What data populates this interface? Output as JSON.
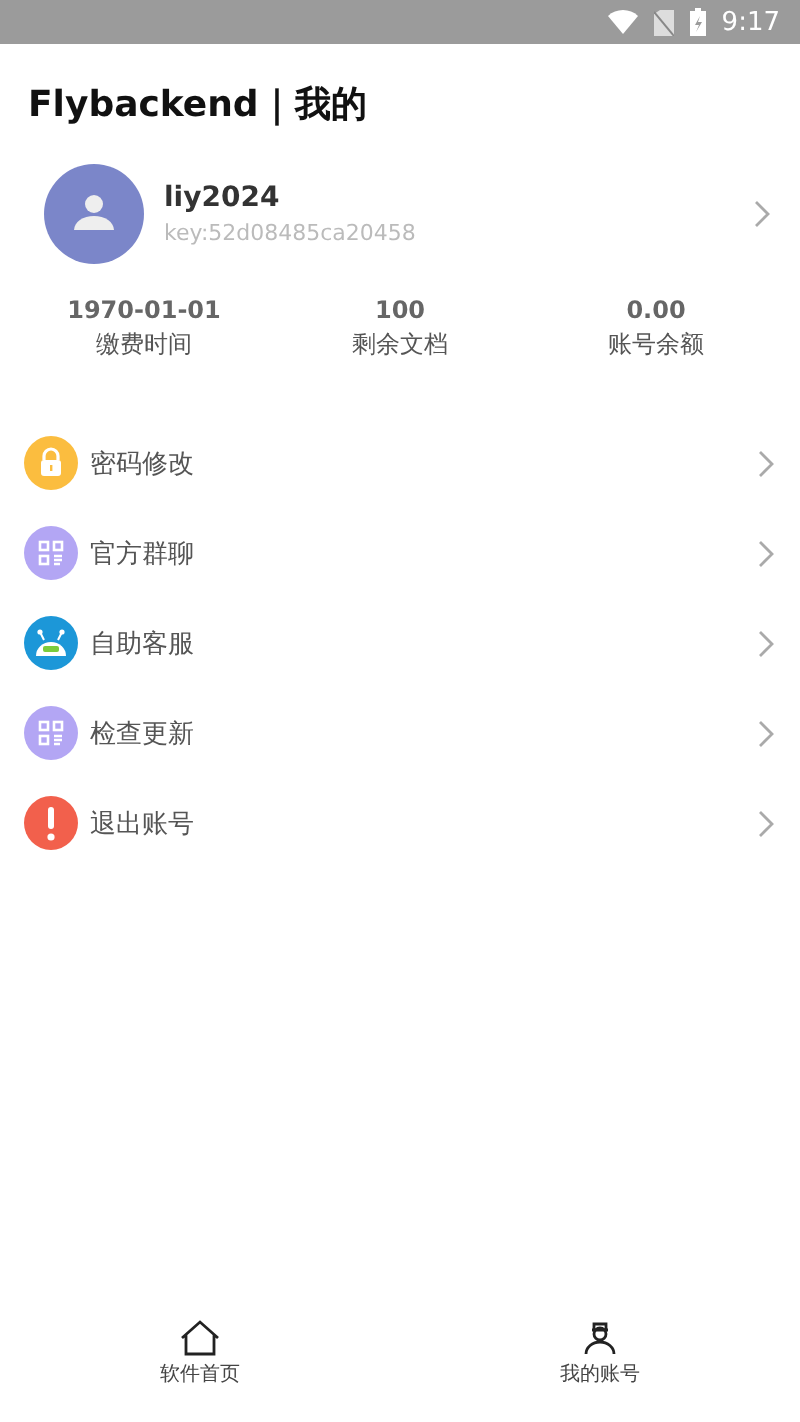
{
  "status_bar": {
    "time": "9:17"
  },
  "title": "Flybackend｜我的",
  "profile": {
    "name": "liy2024",
    "key": "key:52d08485ca20458"
  },
  "stats": [
    {
      "value": "1970-01-01",
      "label": "缴费时间"
    },
    {
      "value": "100",
      "label": "剩余文档"
    },
    {
      "value": "0.00",
      "label": "账号余额"
    }
  ],
  "menu": [
    {
      "kind": "lock",
      "label": "密码修改"
    },
    {
      "kind": "qr",
      "label": "官方群聊"
    },
    {
      "kind": "robot",
      "label": "自助客服"
    },
    {
      "kind": "qr",
      "label": "检查更新"
    },
    {
      "kind": "alert",
      "label": "退出账号"
    }
  ],
  "nav": [
    {
      "kind": "home",
      "label": "软件首页"
    },
    {
      "kind": "user",
      "label": "我的账号"
    }
  ]
}
